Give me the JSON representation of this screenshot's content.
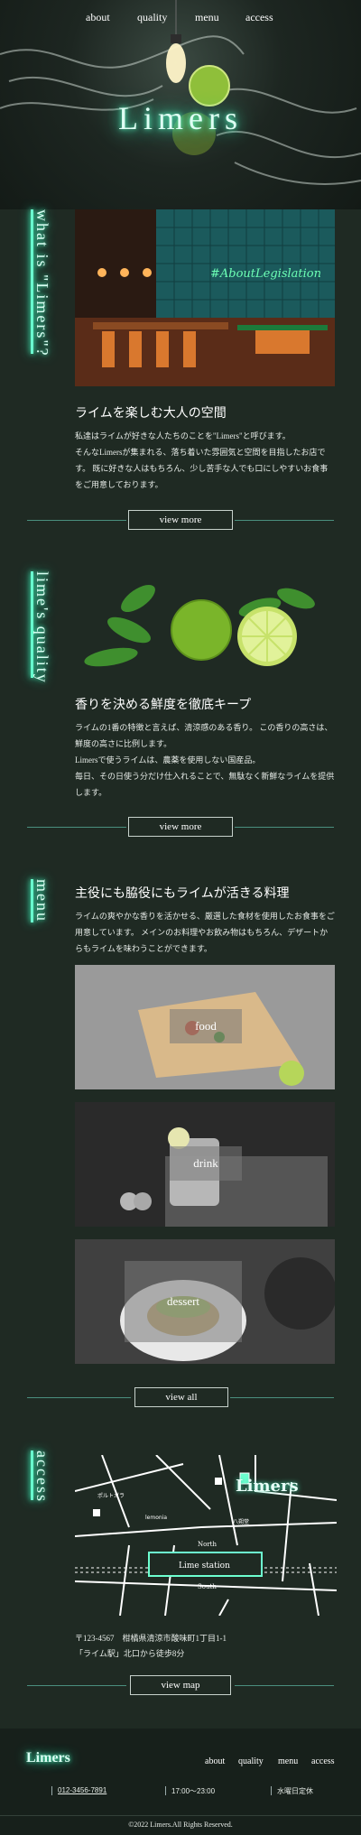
{
  "nav": {
    "about": "about",
    "quality": "quality",
    "menu": "menu",
    "access": "access"
  },
  "hero": {
    "logo": "Limers"
  },
  "about": {
    "vertical_title": "what is \"Limers\"?",
    "neon_sign": "#AboutLegislation",
    "heading": "ライムを楽しむ大人の空間",
    "body": "私達はライムが好きな人たちのことを\"Limers\"と呼びます。\nそんなLimersが集まれる、落ち着いた雰囲気と空間を目指したお店です。 既に好きな人はもちろん、少し苦手な人でも口にしやすいお食事をご用意しております。",
    "button": "view more"
  },
  "quality": {
    "vertical_title": "lime's quality",
    "heading": "香りを決める鮮度を徹底キープ",
    "body": "ライムの1番の特徴と言えば、清涼感のある香り。 この香りの高さは、鮮度の高さに比例します。\nLimersで使うライムは、農薬を使用しない国産品。\n毎日、その日使う分だけ仕入れることで、無駄なく新鮮なライムを提供します。",
    "button": "view more"
  },
  "menu": {
    "vertical_title": "menu",
    "heading": "主役にも脇役にもライムが活きる料理",
    "body": "ライムの爽やかな香りを活かせる、厳選した食材を使用したお食事をご用意しています。 メインのお料理やお飲み物はもちろん、デザートからもライムを味わうことができます。",
    "items": [
      {
        "label": "food"
      },
      {
        "label": "drink"
      },
      {
        "label": "dessert"
      }
    ],
    "button": "view all"
  },
  "access": {
    "vertical_title": "access",
    "map": {
      "brand": "Limers",
      "station": "Lime station",
      "north": "North",
      "south": "South",
      "poi1": "ポルトガラ",
      "poi2": "lemonia",
      "poi3": "八朔堂"
    },
    "address": "〒123-4567　柑橘県清涼市酸味町1丁目1-1",
    "directions": "「ライム駅」北口から徒歩8分",
    "button": "view map"
  },
  "footer": {
    "logo": "Limers",
    "nav": {
      "about": "about",
      "quality": "quality",
      "menu": "menu",
      "access": "access"
    },
    "phone": "012-3456-7891",
    "hours": "17:00〜23:00",
    "holiday": "水曜日定休",
    "copyright": "©2022 Limers.All Rights Reserved."
  }
}
